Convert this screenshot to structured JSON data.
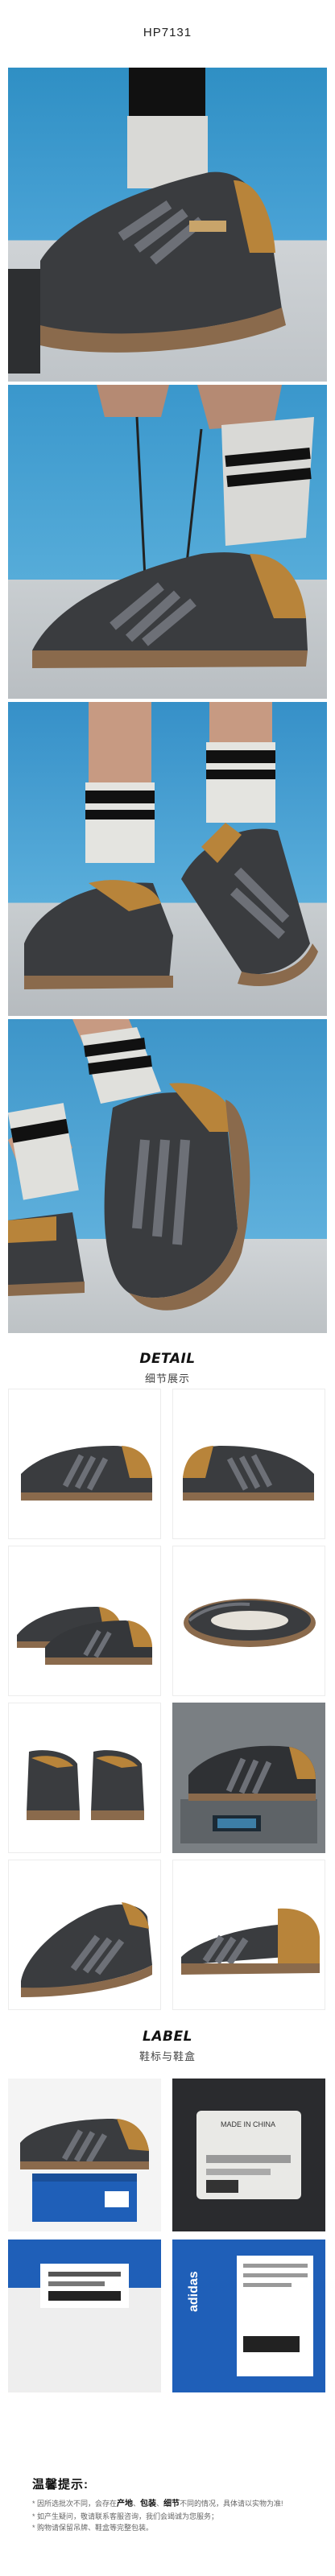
{
  "product_code": "HP7131",
  "detail": {
    "en": "DETAIL",
    "cn": "细节展示"
  },
  "label": {
    "en": "LABEL",
    "cn": "鞋标与鞋盒"
  },
  "label_photos": {
    "tag_text": "MADE IN CHINA",
    "box_brand": "adidas"
  },
  "tips": {
    "title": "温馨提示:",
    "line1_prefix": "* 因所选批次不同，会存在",
    "kw1": "产地",
    "sep1": "、",
    "kw2": "包装",
    "sep2": "、",
    "kw3": "细节",
    "line1_suffix": "不同的情况，具体请以实物为准!",
    "line2": "* 如产生疑问，敬请联系客服咨询，我们会竭诚为您服务；",
    "line3": "* 购物请保留吊牌、鞋盒等完整包装。"
  },
  "colors": {
    "upper": "#3a3c3f",
    "stripes": "#6d7077",
    "heel": "#b8843a",
    "sole": "#8a6a4c",
    "sky": "#3f97cb"
  }
}
